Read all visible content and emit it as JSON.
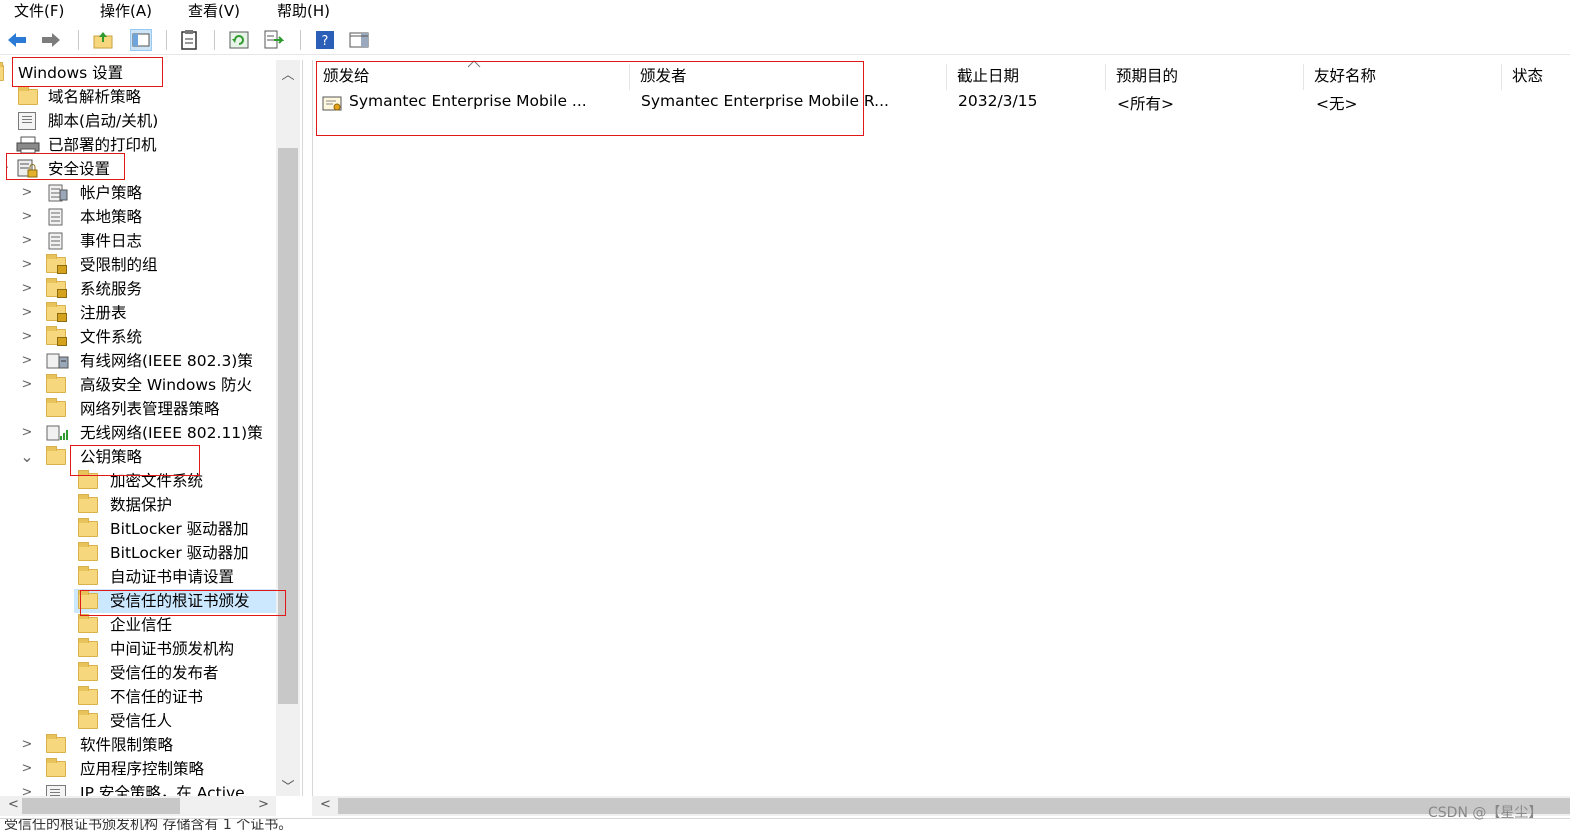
{
  "menu": [
    "文件(F)",
    "操作(A)",
    "查看(V)",
    "帮助(H)"
  ],
  "toolbar": {
    "icons": [
      "back-arrow-icon",
      "forward-arrow-icon",
      "up-folder-icon",
      "show-hide-tree-icon",
      "properties-icon",
      "refresh-icon",
      "export-list-icon",
      "help-icon",
      "show-action-pane-icon"
    ]
  },
  "tree": {
    "root": "Windows 设置",
    "items": [
      {
        "label": "域名解析策略"
      },
      {
        "label": "脚本(启动/关机)"
      },
      {
        "label": "已部署的打印机"
      },
      {
        "label": "安全设置"
      },
      {
        "label": "帐户策略"
      },
      {
        "label": "本地策略"
      },
      {
        "label": "事件日志"
      },
      {
        "label": "受限制的组"
      },
      {
        "label": "系统服务"
      },
      {
        "label": "注册表"
      },
      {
        "label": "文件系统"
      },
      {
        "label": "有线网络(IEEE 802.3)策"
      },
      {
        "label": "高级安全 Windows 防火"
      },
      {
        "label": "网络列表管理器策略"
      },
      {
        "label": "无线网络(IEEE 802.11)策"
      },
      {
        "label": "公钥策略"
      },
      {
        "label": "加密文件系统"
      },
      {
        "label": "数据保护"
      },
      {
        "label": "BitLocker 驱动器加"
      },
      {
        "label": "BitLocker 驱动器加"
      },
      {
        "label": "自动证书申请设置"
      },
      {
        "label": "受信任的根证书颁发"
      },
      {
        "label": "企业信任"
      },
      {
        "label": "中间证书颁发机构"
      },
      {
        "label": "受信任的发布者"
      },
      {
        "label": "不信任的证书"
      },
      {
        "label": "受信任人"
      },
      {
        "label": "软件限制策略"
      },
      {
        "label": "应用程序控制策略"
      },
      {
        "label": "IP 安全策略，在 Active"
      }
    ]
  },
  "table": {
    "columns": [
      "颁发给",
      "颁发者",
      "截止日期",
      "预期目的",
      "友好名称",
      "状态"
    ],
    "rows": [
      {
        "issued_to": "Symantec Enterprise Mobile ...",
        "issued_by": "Symantec Enterprise Mobile R...",
        "expiration": "2032/3/15",
        "purpose": "<所有>",
        "friendly_name": "<无>",
        "status": ""
      }
    ]
  },
  "status_text": "受信任的根证书颁发机构 存储含有 1 个证书。",
  "watermark": "CSDN @【星尘】",
  "colors": {
    "annotation_red": "#e01818",
    "selection": "#cce8ff",
    "folder": "#f6d77e"
  }
}
